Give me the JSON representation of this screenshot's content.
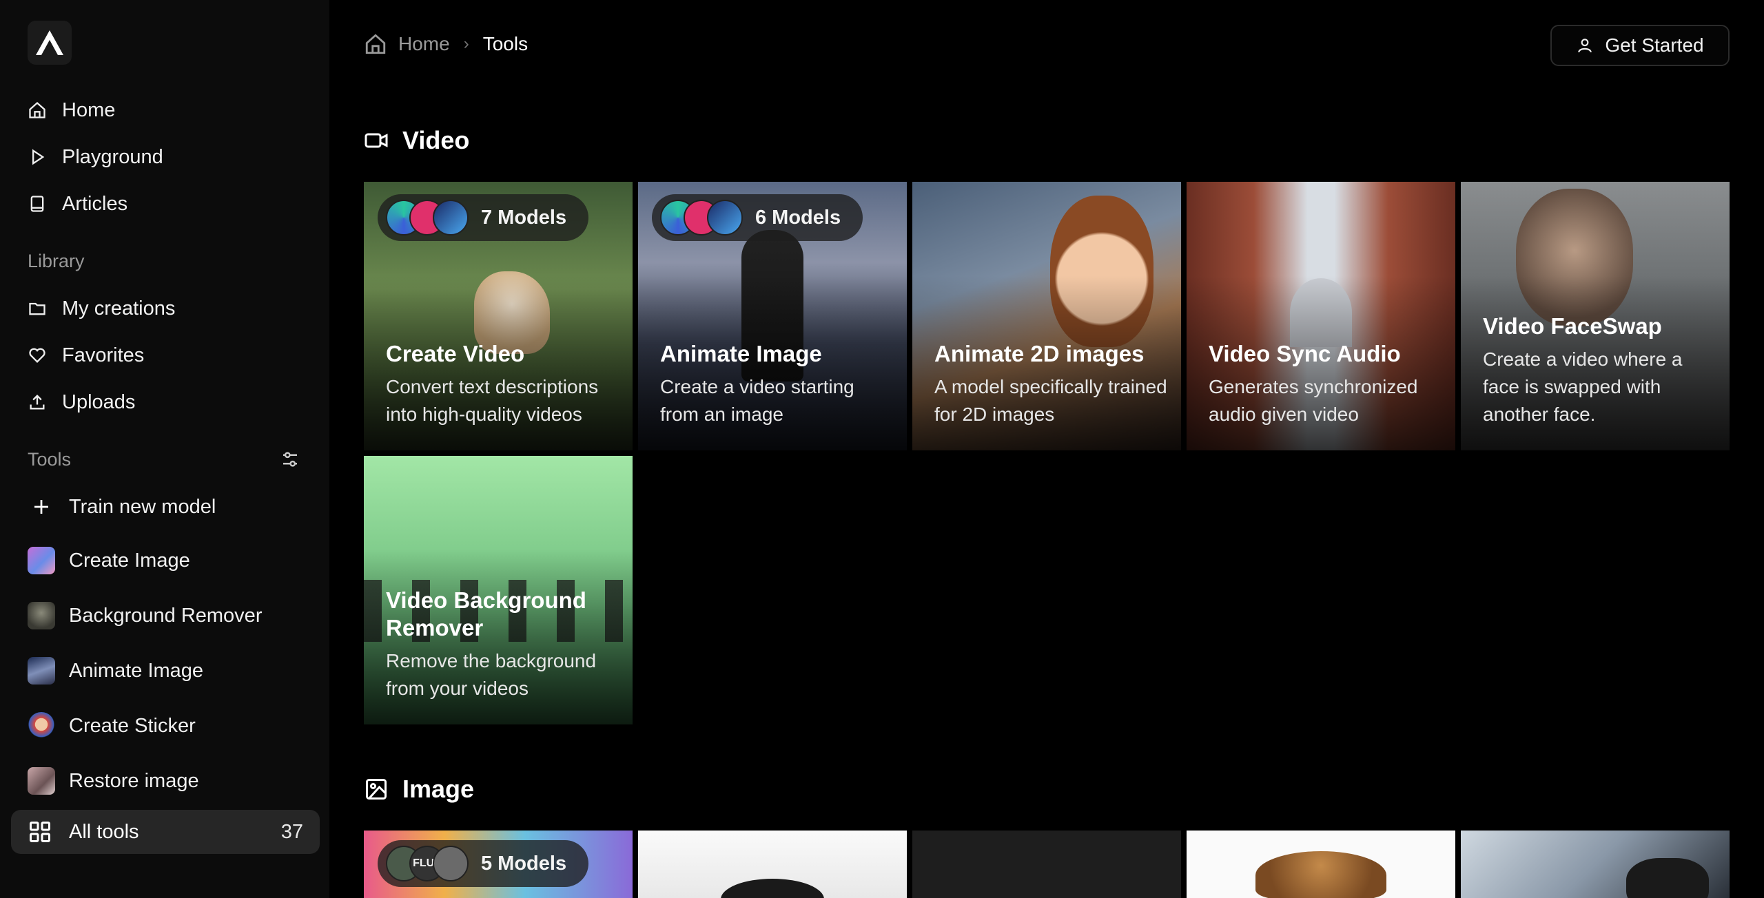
{
  "sidebar": {
    "nav": [
      {
        "label": "Home",
        "icon": "home-icon"
      },
      {
        "label": "Playground",
        "icon": "play-icon"
      },
      {
        "label": "Articles",
        "icon": "book-icon"
      }
    ],
    "library_label": "Library",
    "library": [
      {
        "label": "My creations",
        "icon": "folder-icon"
      },
      {
        "label": "Favorites",
        "icon": "heart-icon"
      },
      {
        "label": "Uploads",
        "icon": "upload-icon"
      }
    ],
    "tools_label": "Tools",
    "tools": [
      {
        "label": "Train new model"
      },
      {
        "label": "Create Image"
      },
      {
        "label": "Background Remover"
      },
      {
        "label": "Animate Image"
      },
      {
        "label": "Create Sticker"
      },
      {
        "label": "Restore image"
      }
    ],
    "all_tools": {
      "label": "All tools",
      "count": "37"
    }
  },
  "breadcrumb": {
    "home": "Home",
    "current": "Tools"
  },
  "header": {
    "get_started": "Get Started"
  },
  "sections": {
    "video": {
      "title": "Video",
      "cards": [
        {
          "title": "Create Video",
          "desc": "Convert text descriptions into high-quality videos",
          "badge": "7 Models"
        },
        {
          "title": "Animate Image",
          "desc": "Create a video starting from an image",
          "badge": "6 Models"
        },
        {
          "title": "Animate 2D images",
          "desc": "A model specifically trained for 2D images"
        },
        {
          "title": "Video Sync Audio",
          "desc": "Generates synchronized audio given video"
        },
        {
          "title": "Video FaceSwap",
          "desc": "Create a video where a face is swapped with another face."
        },
        {
          "title": "Video Background Remover",
          "desc": "Remove the background from your videos"
        }
      ]
    },
    "image": {
      "title": "Image",
      "cards": [
        {
          "badge": "5 Models",
          "avatar_text": "FLUX"
        }
      ]
    }
  },
  "colors": {
    "background": "#000000",
    "sidebar": "#0c0c0c",
    "active_item": "#262626",
    "muted_text": "#9a9a9a"
  }
}
